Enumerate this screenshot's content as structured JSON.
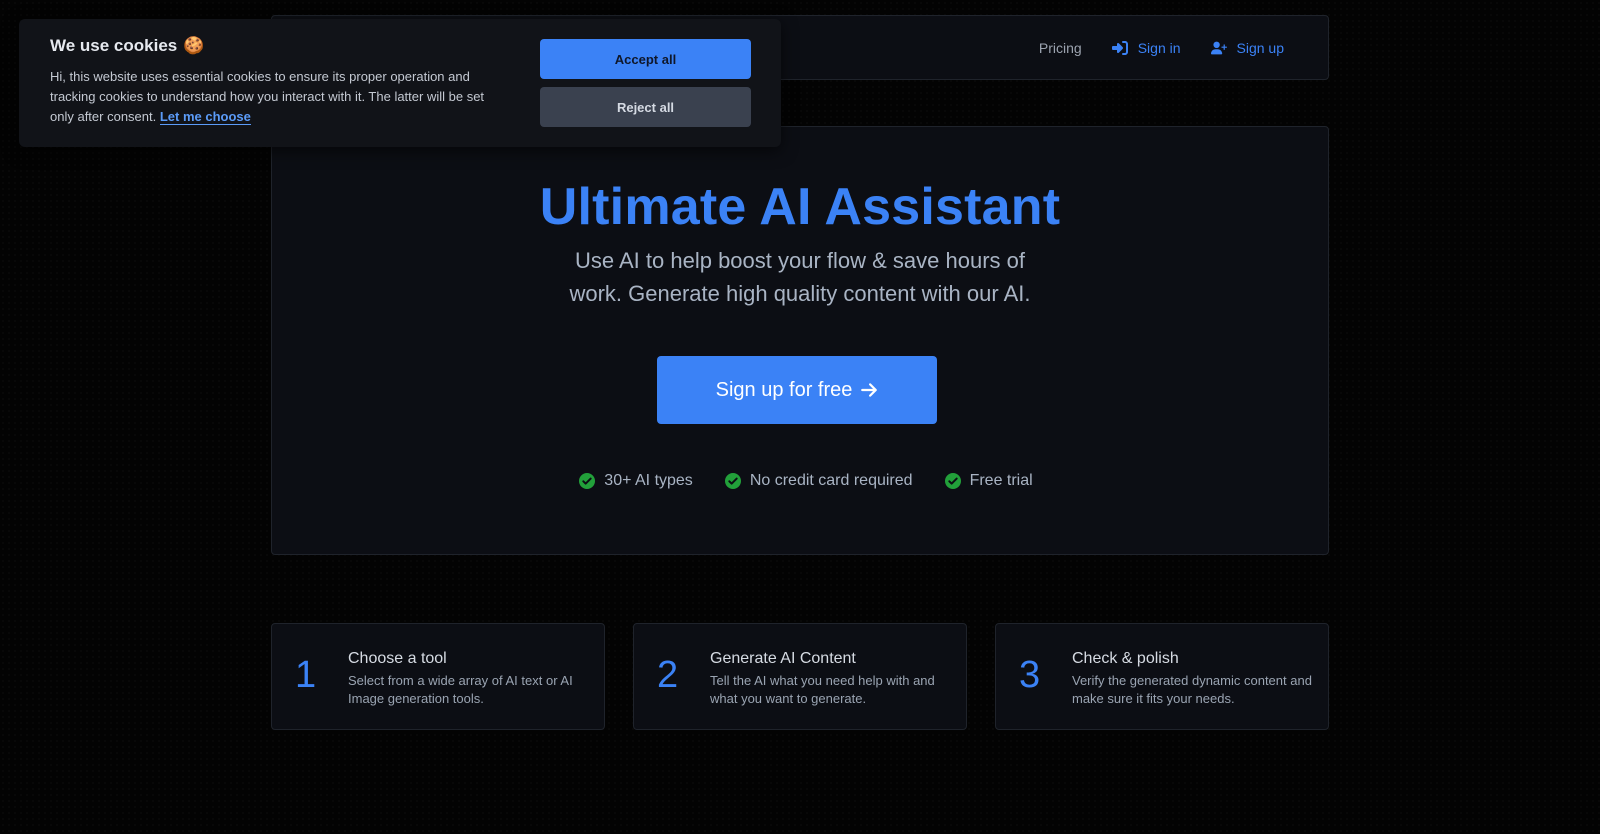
{
  "nav": {
    "pricing": "Pricing",
    "sign_in": "Sign in",
    "sign_up": "Sign up",
    "sign_in_icon": "sign-in-icon",
    "sign_up_icon": "user-plus-icon"
  },
  "hero": {
    "title": "Ultimate AI Assistant",
    "subtitle": "Use AI to help boost your flow & save hours of work. Generate high quality content with our AI.",
    "cta_label": "Sign up for free",
    "cta_icon": "arrow-right-icon",
    "features": [
      {
        "label": "30+ AI types",
        "icon": "check-circle-icon"
      },
      {
        "label": "No credit card required",
        "icon": "check-circle-icon"
      },
      {
        "label": "Free trial",
        "icon": "check-circle-icon"
      }
    ]
  },
  "steps": [
    {
      "number": "1",
      "title": "Choose a tool",
      "description": "Select from a wide array of AI text or AI Image generation tools."
    },
    {
      "number": "2",
      "title": "Generate AI Content",
      "description": "Tell the AI what you need help with and what you want to generate."
    },
    {
      "number": "3",
      "title": "Check & polish",
      "description": "Verify the generated dynamic content and make sure it fits your needs."
    }
  ],
  "cookie_banner": {
    "title": "We use cookies",
    "emoji": "🍪",
    "text": "Hi, this website uses essential cookies to ensure its proper operation and tracking cookies to understand how you interact with it. The latter will be set only after consent.",
    "choose_link": "Let me choose",
    "accept_label": "Accept all",
    "reject_label": "Reject all"
  },
  "colors": {
    "accent": "#3b82f6",
    "success": "#22a03a",
    "background": "#030303",
    "panel": "#0c0e14"
  }
}
